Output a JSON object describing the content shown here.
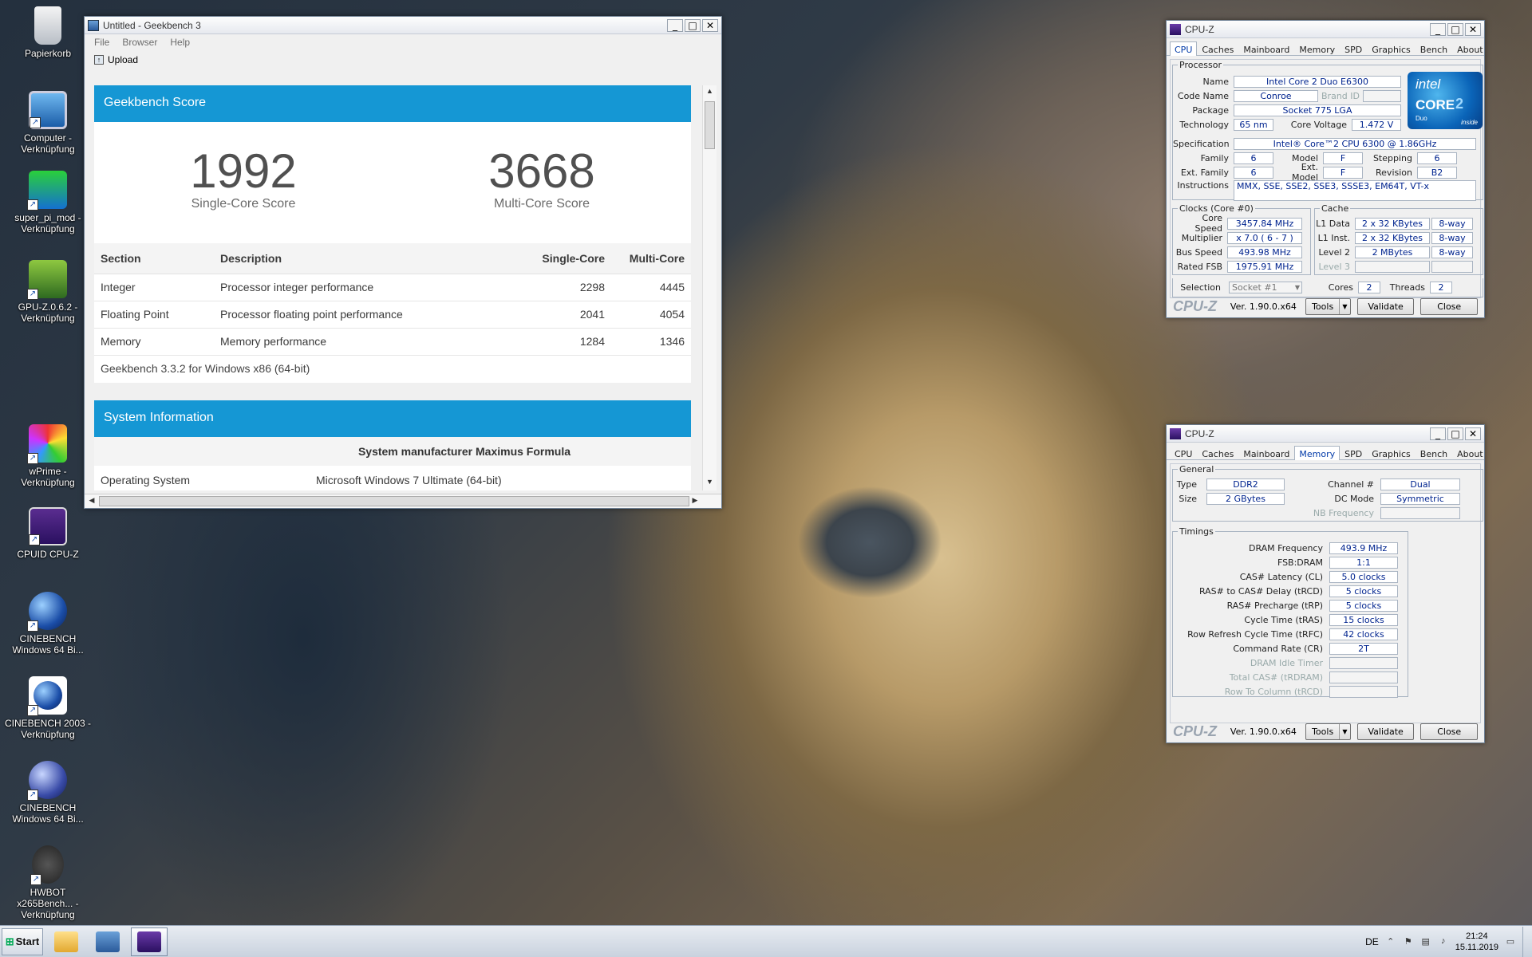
{
  "desktop": {
    "icons": [
      {
        "label": "Papierkorb",
        "name": "recycle-bin-icon"
      },
      {
        "label": "Computer - Verknüpfung",
        "name": "computer-icon"
      },
      {
        "label": "super_pi_mod - Verknüpfung",
        "name": "super-pi-icon"
      },
      {
        "label": "GPU-Z.0.6.2 - Verknüpfung",
        "name": "gpuz-icon"
      },
      {
        "label": "wPrime - Verknüpfung",
        "name": "wprime-icon"
      },
      {
        "label": "CPUID CPU-Z",
        "name": "cpuz-icon"
      },
      {
        "label": "CINEBENCH Windows 64 Bi...",
        "name": "cinebench-icon"
      },
      {
        "label": "CINEBENCH 2003 - Verknüpfung",
        "name": "cinebench2003-icon"
      },
      {
        "label": "CINEBENCH Windows 64 Bi...",
        "name": "cinebench-r15-icon"
      },
      {
        "label": "HWBOT x265Bench... - Verknüpfung",
        "name": "hwbot-icon"
      }
    ]
  },
  "geekbench": {
    "title": "Untitled - Geekbench 3",
    "menu": [
      "File",
      "Browser",
      "Help"
    ],
    "upload_label": "Upload",
    "score_header": "Geekbench Score",
    "single_score": "1992",
    "single_label": "Single-Core Score",
    "multi_score": "3668",
    "multi_label": "Multi-Core Score",
    "table_headers": [
      "Section",
      "Description",
      "Single-Core",
      "Multi-Core"
    ],
    "rows": [
      {
        "section": "Integer",
        "description": "Processor integer performance",
        "single": "2298",
        "multi": "4445"
      },
      {
        "section": "Floating Point",
        "description": "Processor floating point performance",
        "single": "2041",
        "multi": "4054"
      },
      {
        "section": "Memory",
        "description": "Memory performance",
        "single": "1284",
        "multi": "1346"
      }
    ],
    "footer": "Geekbench 3.3.2 for Windows x86 (64-bit)",
    "sys_header": "System Information",
    "sys_title": "System manufacturer Maximus Formula",
    "sys_rows": [
      {
        "key": "Operating System",
        "value": "Microsoft Windows 7 Ultimate (64-bit)"
      }
    ]
  },
  "cpuz_common": {
    "title": "CPU-Z",
    "tabs": [
      "CPU",
      "Caches",
      "Mainboard",
      "Memory",
      "SPD",
      "Graphics",
      "Bench",
      "About"
    ],
    "logo": "CPU-Z",
    "version": "Ver. 1.90.0.x64",
    "tools": "Tools",
    "validate": "Validate",
    "close": "Close"
  },
  "cpuz_cpu": {
    "processor_legend": "Processor",
    "name_label": "Name",
    "name": "Intel Core 2 Duo E6300",
    "codename_label": "Code Name",
    "codename": "Conroe",
    "brandid_label": "Brand ID",
    "package_label": "Package",
    "package": "Socket 775 LGA",
    "technology_label": "Technology",
    "technology": "65 nm",
    "voltage_label": "Core Voltage",
    "voltage": "1.472 V",
    "spec_label": "Specification",
    "spec": "Intel® Core™2 CPU          6300  @ 1.86GHz",
    "family_label": "Family",
    "family": "6",
    "model_label": "Model",
    "model": "F",
    "stepping_label": "Stepping",
    "stepping": "6",
    "extfamily_label": "Ext. Family",
    "extfamily": "6",
    "extmodel_label": "Ext. Model",
    "extmodel": "F",
    "revision_label": "Revision",
    "revision": "B2",
    "instructions_label": "Instructions",
    "instructions": "MMX, SSE, SSE2, SSE3, SSSE3, EM64T, VT-x",
    "intel_logo": {
      "brand": "intel",
      "line": "CORE",
      "num": "2",
      "sub": "Duo",
      "inside": "inside"
    },
    "clocks_legend": "Clocks (Core #0)",
    "corespeed_label": "Core Speed",
    "corespeed": "3457.84 MHz",
    "multiplier_label": "Multiplier",
    "multiplier": "x 7.0 ( 6 - 7 )",
    "busspeed_label": "Bus Speed",
    "busspeed": "493.98 MHz",
    "ratedfsb_label": "Rated FSB",
    "ratedfsb": "1975.91 MHz",
    "cache_legend": "Cache",
    "l1d_label": "L1 Data",
    "l1d": "2 x 32 KBytes",
    "l1d_way": "8-way",
    "l1i_label": "L1 Inst.",
    "l1i": "2 x 32 KBytes",
    "l1i_way": "8-way",
    "l2_label": "Level 2",
    "l2": "2 MBytes",
    "l2_way": "8-way",
    "l3_label": "Level 3",
    "selection_label": "Selection",
    "selection": "Socket #1",
    "cores_label": "Cores",
    "cores": "2",
    "threads_label": "Threads",
    "threads": "2"
  },
  "cpuz_mem": {
    "general_legend": "General",
    "type_label": "Type",
    "type": "DDR2",
    "size_label": "Size",
    "size": "2 GBytes",
    "channel_label": "Channel #",
    "channel": "Dual",
    "dcmode_label": "DC Mode",
    "dcmode": "Symmetric",
    "nbfreq_label": "NB Frequency",
    "timings_legend": "Timings",
    "timings": [
      {
        "label": "DRAM Frequency",
        "value": "493.9 MHz"
      },
      {
        "label": "FSB:DRAM",
        "value": "1:1"
      },
      {
        "label": "CAS# Latency (CL)",
        "value": "5.0 clocks"
      },
      {
        "label": "RAS# to CAS# Delay (tRCD)",
        "value": "5 clocks"
      },
      {
        "label": "RAS# Precharge (tRP)",
        "value": "5 clocks"
      },
      {
        "label": "Cycle Time (tRAS)",
        "value": "15 clocks"
      },
      {
        "label": "Row Refresh Cycle Time (tRFC)",
        "value": "42 clocks"
      },
      {
        "label": "Command Rate (CR)",
        "value": "2T"
      }
    ],
    "timings_disabled": [
      "DRAM Idle Timer",
      "Total CAS# (tRDRAM)",
      "Row To Column (tRCD)"
    ]
  },
  "taskbar": {
    "start": "Start",
    "lang": "DE",
    "time": "21:24",
    "date": "15.11.2019"
  }
}
